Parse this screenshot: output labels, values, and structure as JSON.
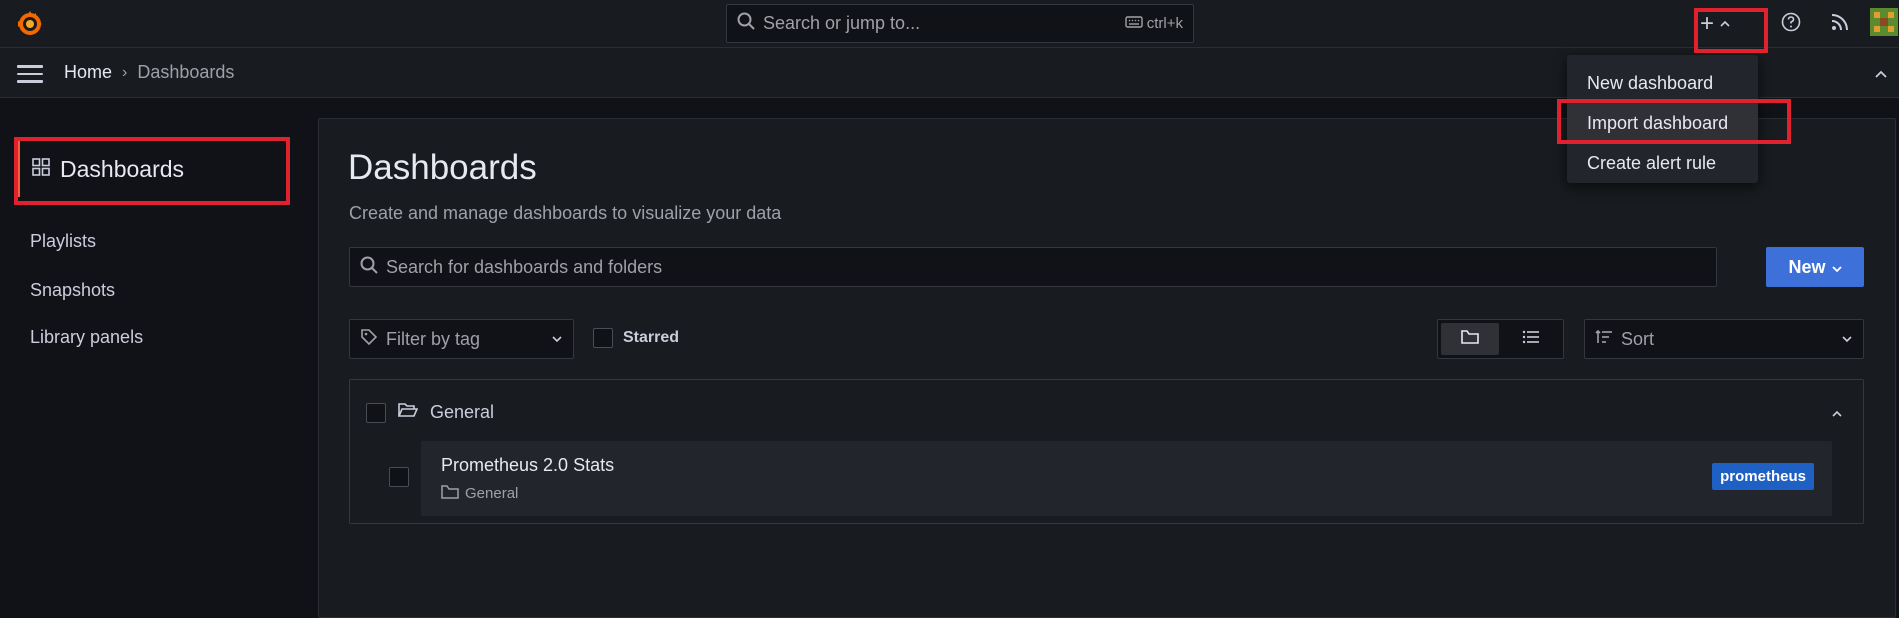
{
  "topbar": {
    "search_placeholder": "Search or jump to...",
    "search_shortcut": "ctrl+k",
    "add_label": "+"
  },
  "breadcrumb": {
    "home": "Home",
    "separator": "›",
    "current": "Dashboards"
  },
  "sidebar": {
    "active": "Dashboards",
    "items": [
      {
        "label": "Playlists"
      },
      {
        "label": "Snapshots"
      },
      {
        "label": "Library panels"
      }
    ]
  },
  "page": {
    "title": "Dashboards",
    "subtitle": "Create and manage dashboards to visualize your data",
    "search_placeholder": "Search for dashboards and folders",
    "new_button": "New",
    "filter_placeholder": "Filter by tag",
    "starred_label": "Starred",
    "sort_placeholder": "Sort"
  },
  "folder": {
    "name": "General",
    "dashboards": [
      {
        "name": "Prometheus 2.0 Stats",
        "location": "General",
        "tag": "prometheus"
      }
    ]
  },
  "new_menu": {
    "items": [
      {
        "label": "New dashboard"
      },
      {
        "label": "Import dashboard"
      },
      {
        "label": "Create alert rule"
      }
    ]
  },
  "colors": {
    "accent": "#3d71d9",
    "highlight_box": "#e0222f",
    "tag": "#1f60c4",
    "active_indicator": "#f55f3e"
  }
}
